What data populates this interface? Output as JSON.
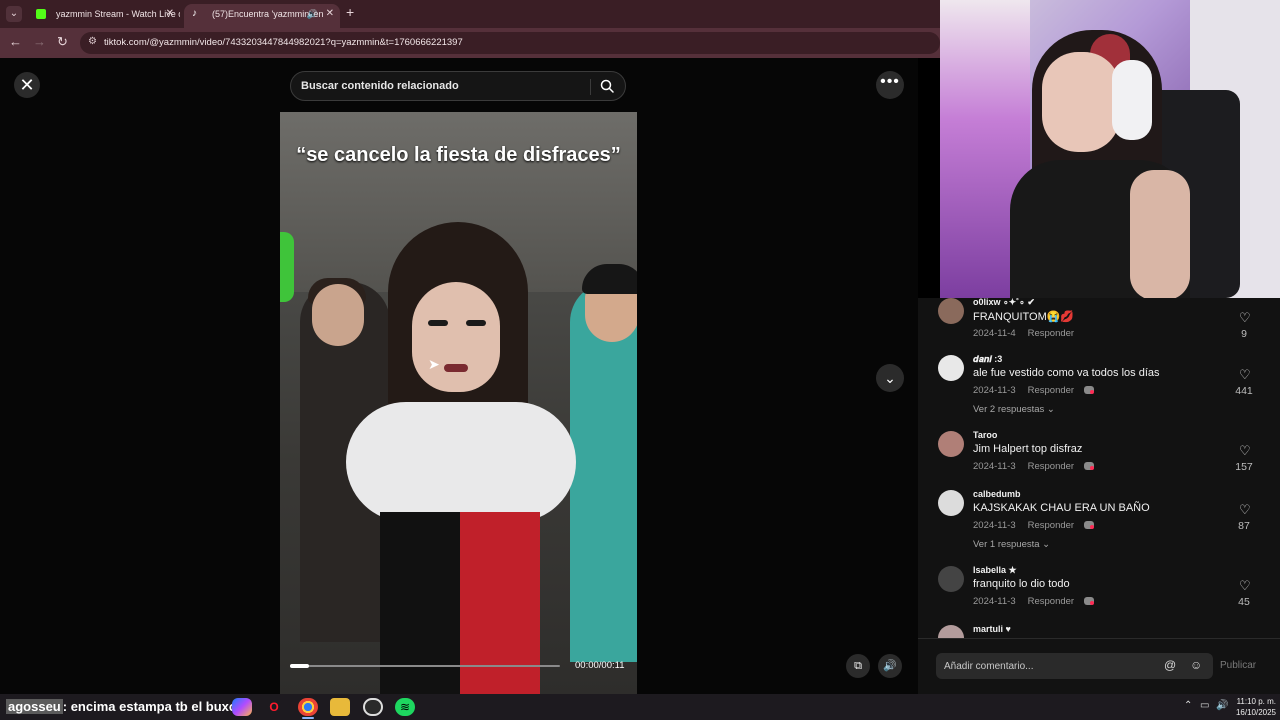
{
  "browser": {
    "tabs": [
      {
        "title": "yazmmin Stream - Watch Live o",
        "favicon": "kick-icon"
      },
      {
        "title": "(57)Encuentra 'yazmmin' en",
        "favicon": "tiktok-icon",
        "active": true
      }
    ],
    "new_tab": "+",
    "url": "tiktok.com/@yazmmin/video/7433203447844982021?q=yazmmin&t=1760666221397"
  },
  "viewer": {
    "search_placeholder": "Buscar contenido relacionado",
    "caption": "“se cancelo la fiesta de disfraces”",
    "time": "00:00/00:11",
    "progress": 0.07
  },
  "comments": [
    {
      "user": "o0lixw ∘✦˚∘ ✔",
      "text": "FRANQUITOM😭💋",
      "date": "2024-11-4",
      "reply_label": "Responder",
      "likes": "9",
      "creator_liked": false
    },
    {
      "user": "𝒅𝒂𝒏𝒊 :3",
      "text": "ale fue vestido como va todos los días",
      "date": "2024-11-3",
      "reply_label": "Responder",
      "likes": "441",
      "creator_liked": true,
      "more": "Ver 2 respuestas ⌄"
    },
    {
      "user": "Taroo",
      "text": "Jim Halpert top disfraz",
      "date": "2024-11-3",
      "reply_label": "Responder",
      "likes": "157",
      "creator_liked": true
    },
    {
      "user": "calbedumb",
      "text": "KAJSKAKAK CHAU ERA UN BAÑO",
      "date": "2024-11-3",
      "reply_label": "Responder",
      "likes": "87",
      "creator_liked": true,
      "more": "Ver 1 respuesta ⌄"
    },
    {
      "user": "Isabella ★",
      "text": "franquito lo dio todo",
      "date": "2024-11-3",
      "reply_label": "Responder",
      "likes": "45",
      "creator_liked": true
    },
    {
      "user": "martuli ♥",
      "text": "",
      "date": "",
      "reply_label": "",
      "likes": "",
      "creator_liked": false
    }
  ],
  "comment_bar": {
    "placeholder": "Añadir comentario...",
    "mention": "@",
    "emoji": "☺",
    "publish": "Publicar"
  },
  "taskbar": {
    "chat_user": "agosseu",
    "chat_message": ": encima estampa tb el buxo",
    "chat_emote": "✨",
    "clock_time": "11:10 p. m.",
    "clock_date": "16/10/2025"
  }
}
